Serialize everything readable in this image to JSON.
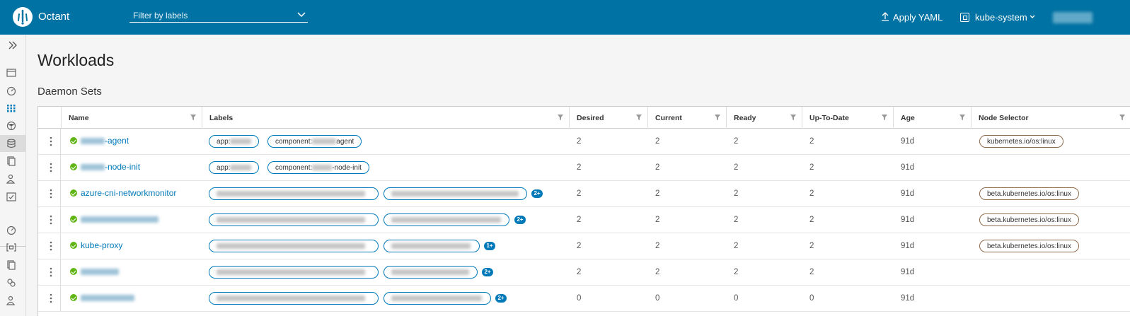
{
  "header": {
    "app_title": "Octant",
    "filter_placeholder": "Filter by labels",
    "apply_yaml_label": "Apply YAML",
    "namespace": "kube-system",
    "bg_color": "#0072a3"
  },
  "sidebar": {
    "icons": [
      "expand-icon",
      "overview-icon",
      "dashboard-icon",
      "workloads-icon",
      "network-icon",
      "storage-icon",
      "config-icon",
      "users-icon",
      "checklist-icon",
      "cluster-dashboard-icon",
      "namespace-icon",
      "crd-icon",
      "roles-icon",
      "user-icon"
    ]
  },
  "page": {
    "title": "Workloads",
    "section": "Daemon Sets"
  },
  "table": {
    "columns": [
      "Name",
      "Labels",
      "Desired",
      "Current",
      "Ready",
      "Up-To-Date",
      "Age",
      "Node Selector"
    ],
    "rows": [
      {
        "name_suffix": "-agent",
        "labels": [
          "app:",
          "component:",
          "agent"
        ],
        "more": "",
        "desired": "2",
        "current": "2",
        "ready": "2",
        "uptodate": "2",
        "age": "91d",
        "selector": "kubernetes.io/os:linux"
      },
      {
        "name_suffix": "-node-init",
        "labels": [
          "app:",
          "component:",
          "-node-init"
        ],
        "more": "",
        "desired": "2",
        "current": "2",
        "ready": "2",
        "uptodate": "2",
        "age": "91d",
        "selector": ""
      },
      {
        "name": "azure-cni-networkmonitor",
        "more": "2+",
        "desired": "2",
        "current": "2",
        "ready": "2",
        "uptodate": "2",
        "age": "91d",
        "selector": "beta.kubernetes.io/os:linux"
      },
      {
        "name": "",
        "more": "2+",
        "desired": "2",
        "current": "2",
        "ready": "2",
        "uptodate": "2",
        "age": "91d",
        "selector": "beta.kubernetes.io/os:linux"
      },
      {
        "name": "kube-proxy",
        "more": "1+",
        "desired": "2",
        "current": "2",
        "ready": "2",
        "uptodate": "2",
        "age": "91d",
        "selector": "beta.kubernetes.io/os:linux"
      },
      {
        "name": "",
        "more": "2+",
        "desired": "2",
        "current": "2",
        "ready": "2",
        "uptodate": "2",
        "age": "91d",
        "selector": ""
      },
      {
        "name": "",
        "more": "2+",
        "desired": "0",
        "current": "0",
        "ready": "0",
        "uptodate": "0",
        "age": "91d",
        "selector": ""
      }
    ]
  }
}
